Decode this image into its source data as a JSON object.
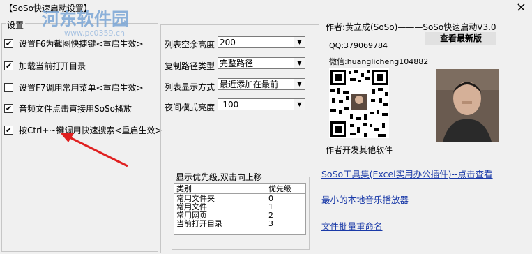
{
  "window": {
    "title": "【SoSo快速启动设置】",
    "close_icon": "×"
  },
  "watermark": {
    "text": "河东软件园",
    "url": "www.pc0359.cn"
  },
  "settings": {
    "group_label": "设置",
    "options": [
      {
        "label": "设置F6为截图快捷键<重启生效>",
        "checked": true
      },
      {
        "label": "加载当前打开目录",
        "checked": true
      },
      {
        "label": "设置F7调用常用菜单<重启生效>",
        "checked": false
      },
      {
        "label": "音频文件点击直接用SoSo播放",
        "checked": true
      },
      {
        "label": "按Ctrl+~键调用快速搜索<重启生效>",
        "checked": true
      }
    ]
  },
  "fields": {
    "list_margin": {
      "label": "列表空余高度",
      "value": "200"
    },
    "copy_path": {
      "label": "复制路径类型",
      "value": "完整路径"
    },
    "list_mode": {
      "label": "列表显示方式",
      "value": "最近添加在最前"
    },
    "night_brightness": {
      "label": "夜间模式亮度",
      "value": "-100"
    }
  },
  "priority": {
    "legend": "显示优先级,双击向上移",
    "headers": {
      "category": "类别",
      "priority": "优先级"
    },
    "rows": [
      {
        "category": "常用文件夹",
        "priority": "0"
      },
      {
        "category": "常用文件",
        "priority": "1"
      },
      {
        "category": "常用网页",
        "priority": "2"
      },
      {
        "category": "当前打开目录",
        "priority": "3"
      }
    ]
  },
  "author": {
    "line": "作者:黄立成(SoSo)———SoSo快速启动V3.0",
    "check_button": "查看最新版",
    "qq": "QQ:379069784",
    "wechat": "微信:huanglicheng104882",
    "other_software_heading": "作者开发其他软件",
    "links": [
      "SoSo工具集(Excel实用办公插件)--点击查看",
      "最小的本地音乐播放器",
      "文件批量重命名"
    ]
  },
  "annotation": {
    "color": "#e02020"
  }
}
